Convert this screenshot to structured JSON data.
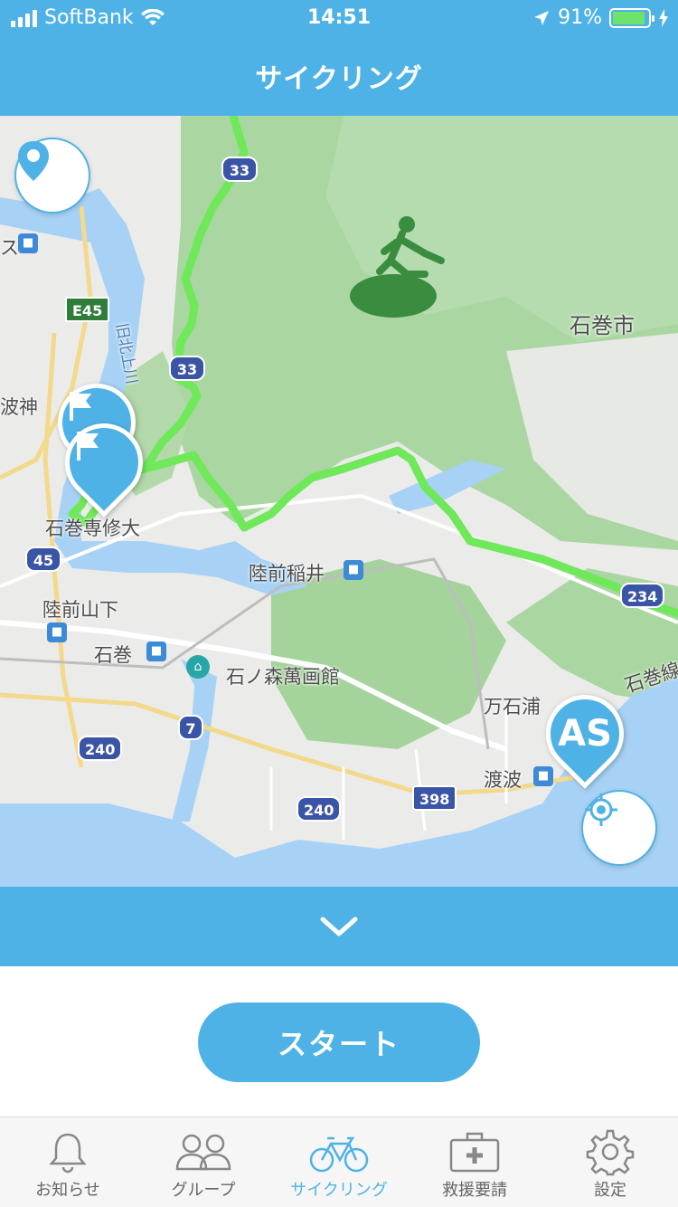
{
  "status": {
    "carrier": "SoftBank",
    "time": "14:51",
    "battery": "91%",
    "battery_level": 0.91
  },
  "nav": {
    "title": "サイクリング"
  },
  "map": {
    "labels": {
      "ishinomaki_city": "石巻市",
      "senshu_univ": "石巻専修大",
      "rikuzen_inai": "陸前稲井",
      "rikuzen_yamashita": "陸前山下",
      "ishinomaki": "石巻",
      "mangakan": "石ノ森萬画館",
      "mangokuura": "万石浦",
      "watanoha": "渡波",
      "ishinomaki_line": "石巻線",
      "kyu_kitakami": "旧北上川",
      "hamonoji": "波神",
      "edge_su": "ス"
    },
    "shields": {
      "r33_top": "33",
      "r33_mid": "33",
      "e45": "E45",
      "r45": "45",
      "r7": "7",
      "r240_left": "240",
      "r240_mid": "240",
      "r398": "398",
      "r234": "234"
    },
    "markers": {
      "as_label": "AS"
    }
  },
  "actions": {
    "start_label": "スタート"
  },
  "tabs": [
    {
      "label": "お知らせ",
      "icon": "bell-icon"
    },
    {
      "label": "グループ",
      "icon": "group-icon"
    },
    {
      "label": "サイクリング",
      "icon": "bicycle-icon"
    },
    {
      "label": "救援要請",
      "icon": "first-aid-kit-icon"
    },
    {
      "label": "設定",
      "icon": "gear-icon"
    }
  ],
  "colors": {
    "accent": "#4fb2e6",
    "route": "#6fe85a",
    "terrain": "#a9d5a0",
    "water": "#a8d2f5",
    "tab_inactive": "#666666"
  }
}
